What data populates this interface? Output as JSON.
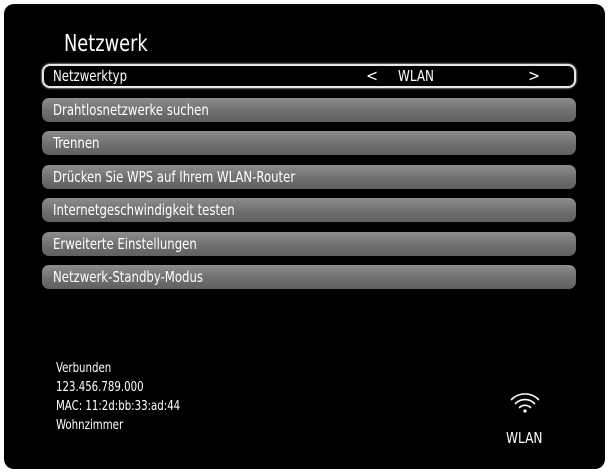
{
  "title": "Netzwerk",
  "menu": {
    "network_type": {
      "label": "Netzwerktyp",
      "arrow_left": "<",
      "value": "WLAN",
      "arrow_right": ">"
    },
    "items": [
      {
        "label": "Drahtlosnetzwerke suchen"
      },
      {
        "label": "Trennen"
      },
      {
        "label": "Drücken Sie WPS auf Ihrem WLAN-Router"
      },
      {
        "label": "Internetgeschwindigkeit testen"
      },
      {
        "label": "Erweiterte Einstellungen"
      },
      {
        "label": "Netzwerk-Standby-Modus"
      }
    ]
  },
  "status": {
    "connection": "Verbunden",
    "ip": "123.456.789.000",
    "mac": "MAC: 11:2d:bb:33:ad:44",
    "location": "Wohnzimmer"
  },
  "connection_type": {
    "icon": "wifi-icon",
    "label": "WLAN"
  }
}
